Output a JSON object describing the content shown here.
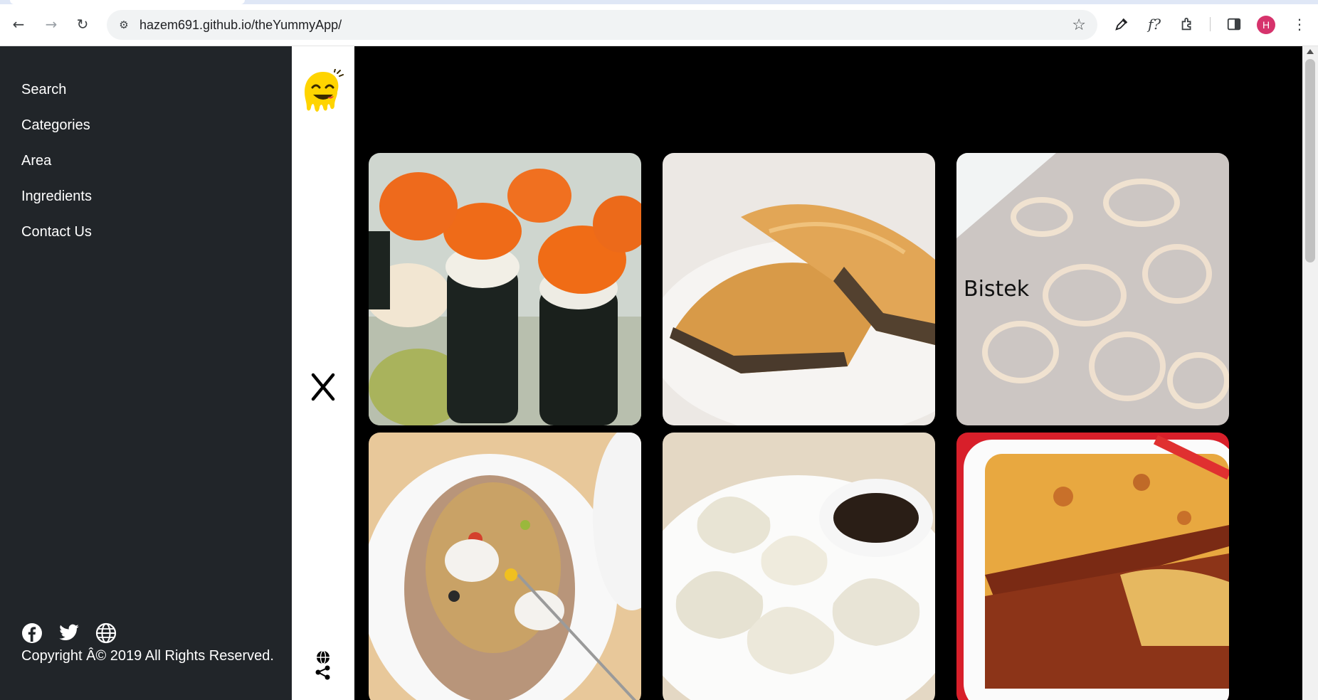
{
  "browser": {
    "url": "hazem691.github.io/theYummyApp/",
    "avatar_letter": "H",
    "icons": [
      "back-icon",
      "forward-icon",
      "reload-icon",
      "site-info-icon",
      "bookmark-star-icon",
      "eyedropper-icon",
      "font-finder-icon",
      "extensions-icon",
      "side-panel-icon",
      "profile-avatar",
      "menu-icon"
    ]
  },
  "sidebar": {
    "items": [
      {
        "label": "Search"
      },
      {
        "label": "Categories"
      },
      {
        "label": "Area"
      },
      {
        "label": "Ingredients"
      },
      {
        "label": "Contact Us"
      }
    ],
    "social_icons": [
      "facebook-icon",
      "twitter-icon",
      "globe-icon"
    ],
    "copyright": "Copyright Â© 2019 All Rights Reserved."
  },
  "toggle_bar": {
    "icons": [
      "yummy-logo",
      "close-icon",
      "share-icon"
    ]
  },
  "meals": [
    {
      "name": "",
      "hovered": false
    },
    {
      "name": "",
      "hovered": false
    },
    {
      "name": "Bistek",
      "hovered": true
    },
    {
      "name": "",
      "hovered": false
    },
    {
      "name": "",
      "hovered": false
    },
    {
      "name": "",
      "hovered": false
    }
  ],
  "colors": {
    "sidebar_bg": "#212529",
    "page_bg": "#000000",
    "logo_yellow": "#FFD400",
    "avatar": "#d6336c"
  }
}
